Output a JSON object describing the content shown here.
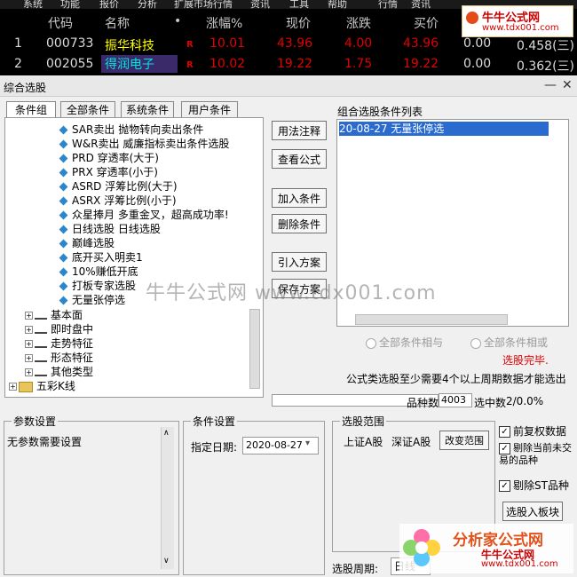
{
  "menu": [
    "系统",
    "功能",
    "报价",
    "分析",
    "扩展市场行情",
    "资讯",
    "工具",
    "帮助",
    "行情",
    "资讯",
    "交易",
    "服务"
  ],
  "table": {
    "headers": [
      "代码",
      "名称",
      "•",
      "涨幅%",
      "现价",
      "涨跌",
      "买价",
      "卖价"
    ],
    "rows": [
      {
        "idx": "1",
        "code": "000733",
        "name": "振华科技",
        "flag": "R",
        "pct": "10.01",
        "price": "43.96",
        "chg": "4.00",
        "bid": "43.96",
        "ask": "0.00",
        "extra": "0.458(三)"
      },
      {
        "idx": "2",
        "code": "002055",
        "name": "得润电子",
        "flag": "R",
        "pct": "10.02",
        "price": "19.22",
        "chg": "1.75",
        "bid": "19.22",
        "ask": "0.00",
        "extra": "0.362(三)"
      }
    ]
  },
  "dialog": {
    "title": "综合选股",
    "tabs": [
      "条件组",
      "全部条件",
      "系统条件",
      "用户条件"
    ],
    "tree_leaves": [
      "SAR卖出 抛物转向卖出条件",
      "W&R卖出 威廉指标卖出条件选股",
      "PRD 穿透率(大于)",
      "PRX 穿透率(小于)",
      "ASRD 浮筹比例(大于)",
      "ASRX 浮筹比例(小于)",
      "众星捧月 多重金叉，超高成功率!",
      "日线选股 日线选股",
      "巅峰选股",
      "底开买入明卖1",
      "10%赚低开底",
      "打板专家选股",
      "无量张停选"
    ],
    "tree_groups": [
      "基本面",
      "即时盘中",
      "走势特征",
      "形态特征",
      "其他类型"
    ],
    "tree_folder": "五彩K线",
    "buttons": {
      "formula_note": "用法注释",
      "view_formula": "查看公式",
      "add_cond": "加入条件",
      "del_cond": "删除条件",
      "import_plan": "引入方案",
      "save_plan": "保存方案"
    },
    "combo_label": "组合选股条件列表",
    "combo_item": "20-08-27 无量张停选",
    "radio_and": "全部条件相与",
    "radio_or": "全部条件相或",
    "done": "选股完毕.",
    "notice": "公式类选股至少需要4个以上周期数据才能选出",
    "count_label": "品种数",
    "count_value": "4003",
    "selected_label": "选中数",
    "selected_value": "2/0.0%",
    "param_title": "参数设置",
    "param_text": "无参数需要设置",
    "cond_title": "条件设置",
    "date_label": "指定日期:",
    "date_value": "2020-08-27",
    "range_title": "选股范围",
    "range_sh": "上证A股",
    "range_sz": "深证A股",
    "change_range": "改变范围",
    "chk_fq": "前复权数据",
    "chk_exclude_new": "剔除当前未交易的品种",
    "chk_exclude_st": "剔除ST品种",
    "to_block": "选股入板块",
    "period_label": "选股周期:",
    "period_value": "日线"
  },
  "branding": {
    "logo_top_title": "牛牛公式网",
    "logo_top_url": "www.tdx001.com",
    "watermark": "牛牛公式网 www.tdx001.com",
    "logo_bottom_title": "分析家公式网",
    "logo_bottom_sub": "牛牛公式网",
    "logo_bottom_url": "www.tdx001.com"
  },
  "colors": {
    "red": "#e00000",
    "yellow": "#ffff00",
    "cyan": "#00e5e5",
    "selection": "#2a6bd0"
  }
}
